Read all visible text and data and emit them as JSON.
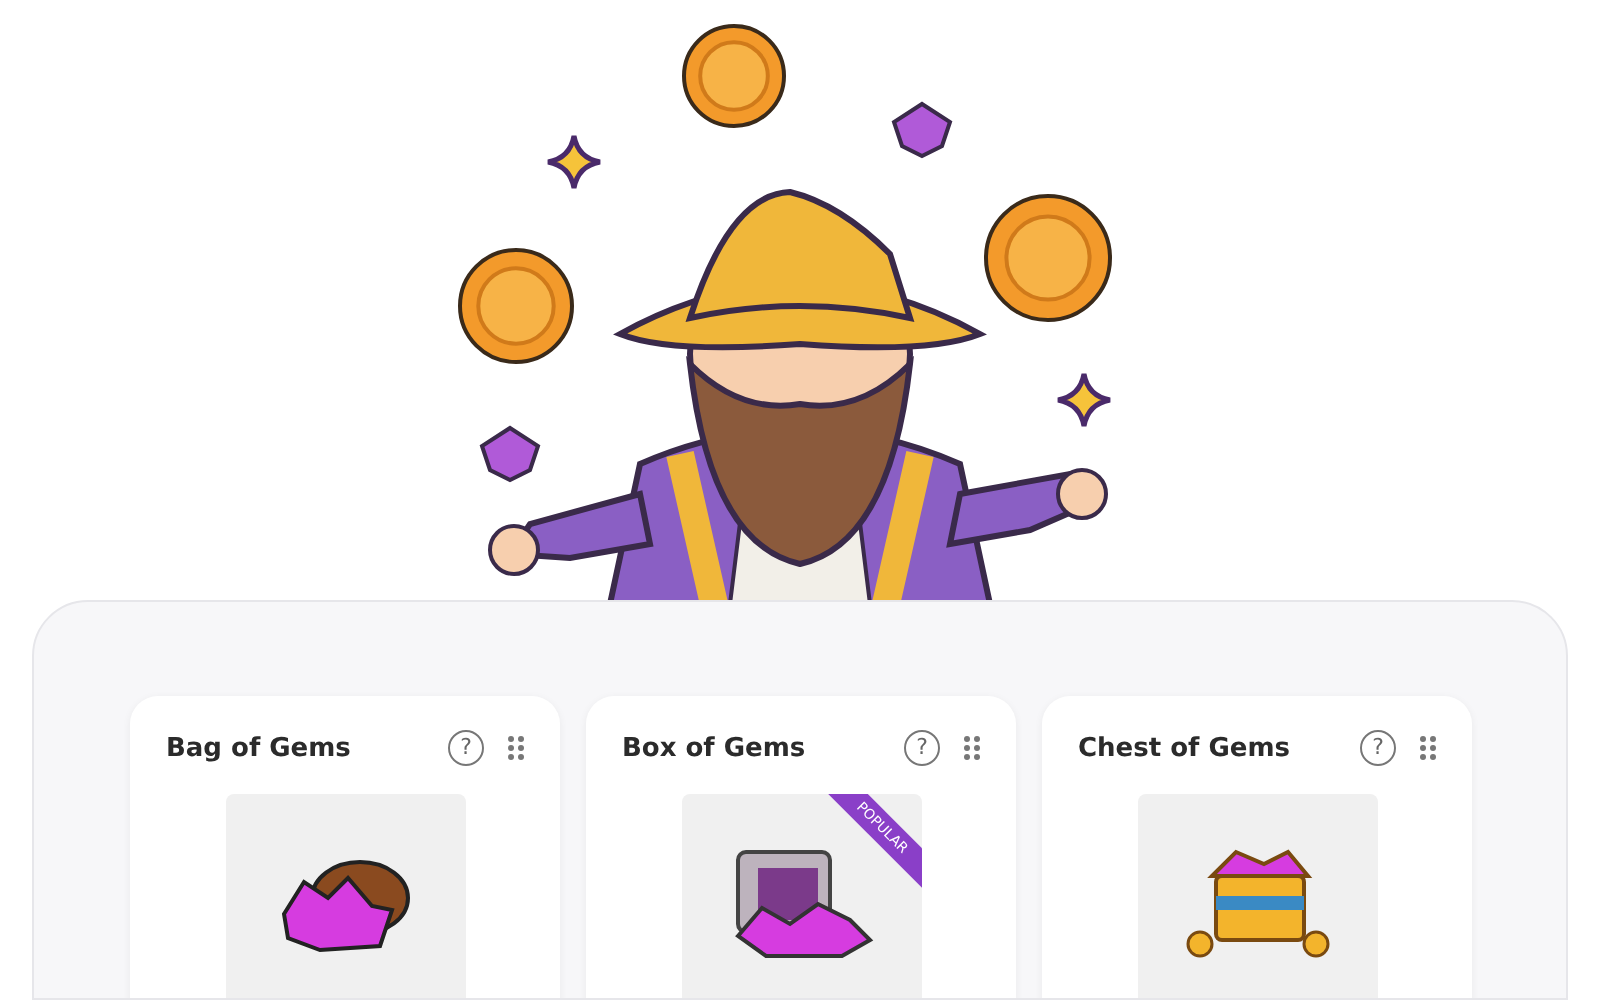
{
  "cards": [
    {
      "title": "Bag of Gems",
      "help": "?",
      "kind": "bag"
    },
    {
      "title": "Box of Gems",
      "help": "?",
      "kind": "safe",
      "badge": "POPULAR"
    },
    {
      "title": "Chest of Gems",
      "help": "?",
      "kind": "chest"
    }
  ]
}
